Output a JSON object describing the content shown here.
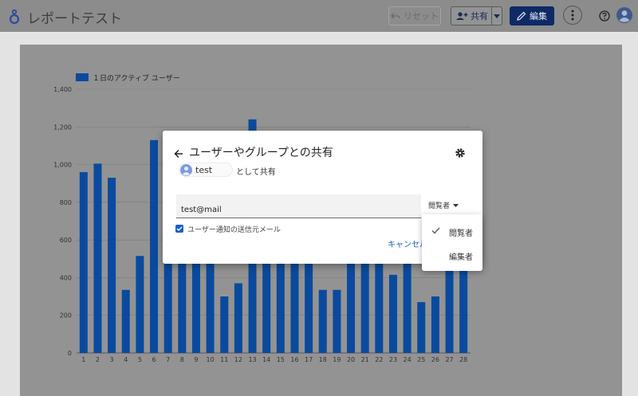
{
  "header": {
    "report_title": "レポートテスト",
    "reset_label": "リセット",
    "share_label": "共有",
    "edit_label": "編集"
  },
  "chart_data": {
    "type": "bar",
    "legend": "１日のアクティブ ユーザー",
    "series_name": "１日のアクティブ ユーザー",
    "categories": [
      "1",
      "2",
      "3",
      "4",
      "5",
      "6",
      "7",
      "8",
      "9",
      "10",
      "11",
      "12",
      "13",
      "14",
      "15",
      "16",
      "17",
      "18",
      "19",
      "20",
      "21",
      "22",
      "23",
      "24",
      "25",
      "26",
      "27",
      "28"
    ],
    "values": [
      960,
      1005,
      930,
      335,
      515,
      1130,
      560,
      540,
      565,
      540,
      300,
      370,
      1240,
      1175,
      800,
      820,
      620,
      335,
      335,
      780,
      790,
      585,
      415,
      560,
      270,
      300,
      800,
      720
    ],
    "ylim": [
      0,
      1400
    ],
    "yticks": [
      0,
      200,
      400,
      600,
      800,
      1000,
      1200,
      1400
    ],
    "ytick_labels": [
      "0",
      "200",
      "400",
      "600",
      "800",
      "1,000",
      "1,200",
      "1,400"
    ],
    "bar_color": "#0a4a9e",
    "grid": true,
    "legend_position": "top-left"
  },
  "dialog": {
    "title": "ユーザーやグループとの共有",
    "user_name": "test",
    "share_as_text": "として共有",
    "email_value": "test@mail",
    "role_selected": "閲覧者",
    "notify_label": "ユーザー通知の送信元メール",
    "cancel_label": "キャンセル"
  },
  "role_menu": {
    "items": [
      {
        "label": "閲覧者",
        "selected": true
      },
      {
        "label": "編集者",
        "selected": false
      }
    ]
  }
}
